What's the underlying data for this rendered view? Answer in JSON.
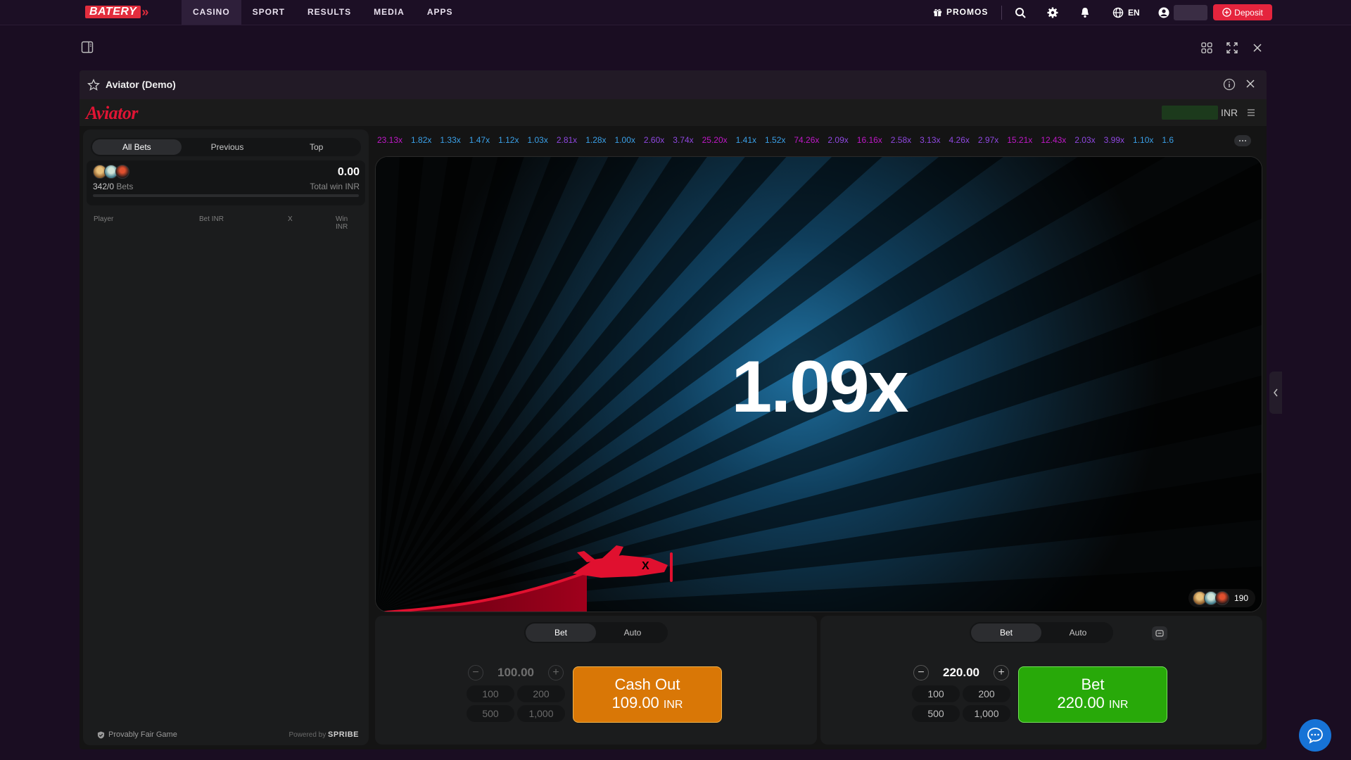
{
  "site": {
    "brand": "BATERY",
    "nav": [
      "CASINO",
      "SPORT",
      "RESULTS",
      "MEDIA",
      "APPS"
    ],
    "promos_label": "PROMOS",
    "lang": "EN",
    "deposit_label": "Deposit",
    "colors": {
      "accent": "#e5243d",
      "bg": "#1a0d22"
    }
  },
  "game_window": {
    "title": "Aviator (Demo)",
    "game_logo": "Aviator",
    "currency": "INR"
  },
  "bets_panel": {
    "tabs": [
      "All Bets",
      "Previous",
      "Top"
    ],
    "active_tab": "All Bets",
    "bets_count": "342/0",
    "bets_word": "Bets",
    "total_win": "0.00",
    "total_win_label": "Total win INR",
    "columns": [
      "Player",
      "Bet INR",
      "X",
      "Win INR"
    ],
    "fair_label": "Provably Fair Game",
    "powered_by": "Powered by",
    "provider": "SPRIBE"
  },
  "history": [
    {
      "v": "23.13x",
      "c": "#c018c8"
    },
    {
      "v": "1.82x",
      "c": "#3aa0e8"
    },
    {
      "v": "1.33x",
      "c": "#3aa0e8"
    },
    {
      "v": "1.47x",
      "c": "#3aa0e8"
    },
    {
      "v": "1.12x",
      "c": "#3aa0e8"
    },
    {
      "v": "1.03x",
      "c": "#3aa0e8"
    },
    {
      "v": "2.81x",
      "c": "#8f47e0"
    },
    {
      "v": "1.28x",
      "c": "#3aa0e8"
    },
    {
      "v": "1.00x",
      "c": "#3aa0e8"
    },
    {
      "v": "2.60x",
      "c": "#8f47e0"
    },
    {
      "v": "3.74x",
      "c": "#8f47e0"
    },
    {
      "v": "25.20x",
      "c": "#c018c8"
    },
    {
      "v": "1.41x",
      "c": "#3aa0e8"
    },
    {
      "v": "1.52x",
      "c": "#3aa0e8"
    },
    {
      "v": "74.26x",
      "c": "#c018c8"
    },
    {
      "v": "2.09x",
      "c": "#8f47e0"
    },
    {
      "v": "16.16x",
      "c": "#c018c8"
    },
    {
      "v": "2.58x",
      "c": "#8f47e0"
    },
    {
      "v": "3.13x",
      "c": "#8f47e0"
    },
    {
      "v": "4.26x",
      "c": "#8f47e0"
    },
    {
      "v": "2.97x",
      "c": "#8f47e0"
    },
    {
      "v": "15.21x",
      "c": "#c018c8"
    },
    {
      "v": "12.43x",
      "c": "#c018c8"
    },
    {
      "v": "2.03x",
      "c": "#8f47e0"
    },
    {
      "v": "3.99x",
      "c": "#8f47e0"
    },
    {
      "v": "1.10x",
      "c": "#3aa0e8"
    },
    {
      "v": "1.6",
      "c": "#3aa0e8"
    }
  ],
  "stage": {
    "multiplier": "1.09x",
    "online_players": "190"
  },
  "bet1": {
    "tabs": [
      "Bet",
      "Auto"
    ],
    "amount": "100.00",
    "quick": [
      "100",
      "200",
      "500",
      "1,000"
    ],
    "action_line1": "Cash Out",
    "action_amount": "109.00",
    "action_currency": "INR",
    "action_color": "#d97706"
  },
  "bet2": {
    "tabs": [
      "Bet",
      "Auto"
    ],
    "amount": "220.00",
    "quick": [
      "100",
      "200",
      "500",
      "1,000"
    ],
    "action_line1": "Bet",
    "action_amount": "220.00",
    "action_currency": "INR",
    "action_color": "#28a909"
  }
}
